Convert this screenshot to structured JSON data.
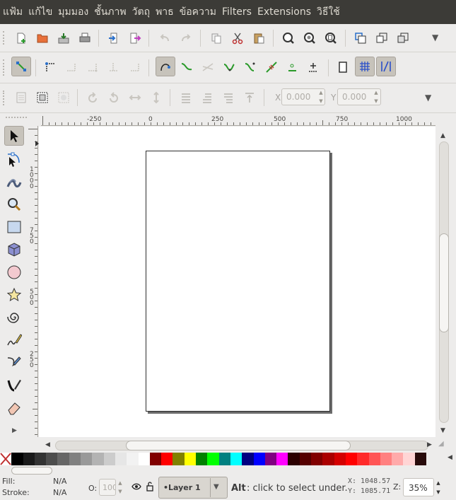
{
  "menu": [
    "แฟ้ม",
    "แก้ไข",
    "มุมมอง",
    "ชั้นภาพ",
    "วัตถุ",
    "พาธ",
    "ข้อความ",
    "Filters",
    "Extensions",
    "วิธีใช้"
  ],
  "transform_toolbar": {
    "x_label": "X",
    "x_value": "0.000",
    "y_label": "Y",
    "y_value": "0.000"
  },
  "rulers": {
    "horizontal": [
      "-250",
      "0",
      "250",
      "500",
      "750",
      "1000"
    ],
    "vertical": [
      [
        "1",
        "0",
        "0",
        "0"
      ],
      [
        "7",
        "5",
        "0"
      ],
      [
        "5",
        "0",
        "0"
      ],
      [
        "2",
        "5",
        "0"
      ]
    ]
  },
  "palette": [
    "#000000",
    "#1a1a1a",
    "#333333",
    "#4d4d4d",
    "#666666",
    "#808080",
    "#999999",
    "#b3b3b3",
    "#cccccc",
    "#e6e6e6",
    "#f2f2f2",
    "#ffffff",
    "#800000",
    "#ff0000",
    "#808000",
    "#ffff00",
    "#008000",
    "#00ff00",
    "#008080",
    "#00ffff",
    "#000080",
    "#0000ff",
    "#800080",
    "#ff00ff",
    "#2b0000",
    "#550000",
    "#800000",
    "#aa0000",
    "#d40000",
    "#ff0000",
    "#ff2a2a",
    "#ff5555",
    "#ff8080",
    "#ffaaaa",
    "#ffd5d5",
    "#280b0b"
  ],
  "status": {
    "fill_label": "Fill:",
    "fill_value": "N/A",
    "stroke_label": "Stroke:",
    "stroke_value": "N/A",
    "opacity_label": "O:",
    "opacity_value": "100",
    "layer": "•Layer 1",
    "hint_key": "Alt",
    "hint_text": ": click to select under.",
    "cursor_x": "X: 1048.57",
    "cursor_y": "Y: 1085.71",
    "zoom_label": "Z:",
    "zoom_value": "35%"
  },
  "colors": {
    "menubar_bg": "#3c3b37",
    "menubar_text": "#dfdbd2",
    "window_bg": "#edeceb",
    "canvas_bg": "#ffffff"
  }
}
